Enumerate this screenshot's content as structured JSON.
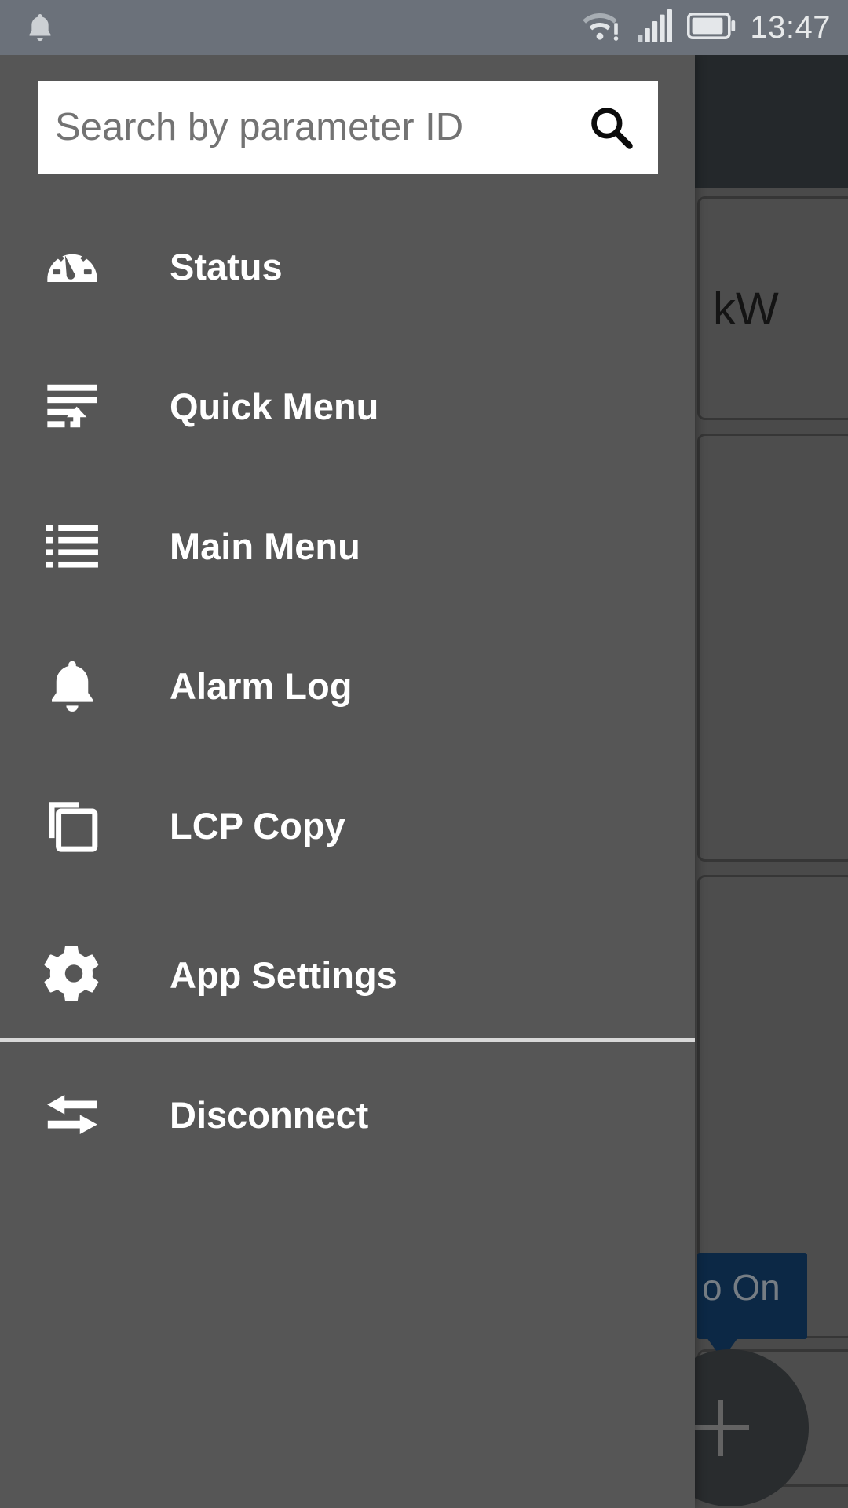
{
  "status_bar": {
    "notification_icon": "bell-icon",
    "wifi_icon": "wifi-warning-icon",
    "signal_icon": "cellular-signal-icon",
    "battery_icon": "battery-icon",
    "time": "13:47"
  },
  "drawer": {
    "search": {
      "placeholder": "Search by parameter ID",
      "value": "",
      "icon": "search-icon"
    },
    "items": [
      {
        "label": "Status",
        "icon": "gauge-icon"
      },
      {
        "label": "Quick Menu",
        "icon": "list-arrow-icon"
      },
      {
        "label": "Main Menu",
        "icon": "bulleted-list-icon"
      },
      {
        "label": "Alarm Log",
        "icon": "bell-icon"
      },
      {
        "label": "LCP Copy",
        "icon": "copy-icon"
      }
    ],
    "footer_items": [
      {
        "label": "App Settings",
        "icon": "gear-icon"
      },
      {
        "label": "Disconnect",
        "icon": "swap-arrows-icon"
      }
    ]
  },
  "background_app": {
    "unit_label": "kW",
    "tooltip_text": "o On",
    "fab_icon": "plus-icon"
  },
  "colors": {
    "status_bar": "#6b717a",
    "drawer_bg": "#565656",
    "scrim": "rgba(0,0,0,0.30)",
    "app_bar": "#343a3e",
    "tooltip": "#123a63",
    "text_primary": "#ffffff",
    "placeholder": "#737373"
  }
}
